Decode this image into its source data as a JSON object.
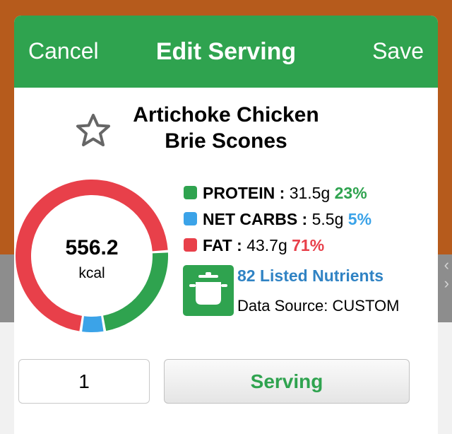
{
  "header": {
    "cancel_label": "Cancel",
    "title": "Edit Serving",
    "save_label": "Save"
  },
  "food": {
    "name_line1": "Artichoke Chicken",
    "name_line2": "Brie Scones"
  },
  "calories": {
    "value": "556.2",
    "unit": "kcal"
  },
  "macros": [
    {
      "name": "PROTEIN",
      "sep": " : ",
      "amount": "31.5g",
      "percent": "23%",
      "color": "#2fa34f"
    },
    {
      "name": "NET CARBS",
      "sep": " : ",
      "amount": "5.5g",
      "percent": "5%",
      "color": "#3ba3e8"
    },
    {
      "name": "FAT",
      "sep": " : ",
      "amount": "43.7g",
      "percent": "71%",
      "color": "#e8404a"
    }
  ],
  "chart_data": {
    "type": "pie",
    "style": "donut",
    "categories": [
      "PROTEIN",
      "NET CARBS",
      "FAT"
    ],
    "values": [
      23,
      5,
      71
    ],
    "colors": [
      "#2fa34f",
      "#3ba3e8",
      "#e8404a"
    ]
  },
  "nutrients": {
    "link_label": "82 Listed Nutrients",
    "data_source": "Data Source: CUSTOM",
    "icon": "pot-icon"
  },
  "serving": {
    "quantity": "1",
    "unit_label": "Serving"
  },
  "background": {
    "glyphs": [
      "‹",
      "›"
    ]
  }
}
